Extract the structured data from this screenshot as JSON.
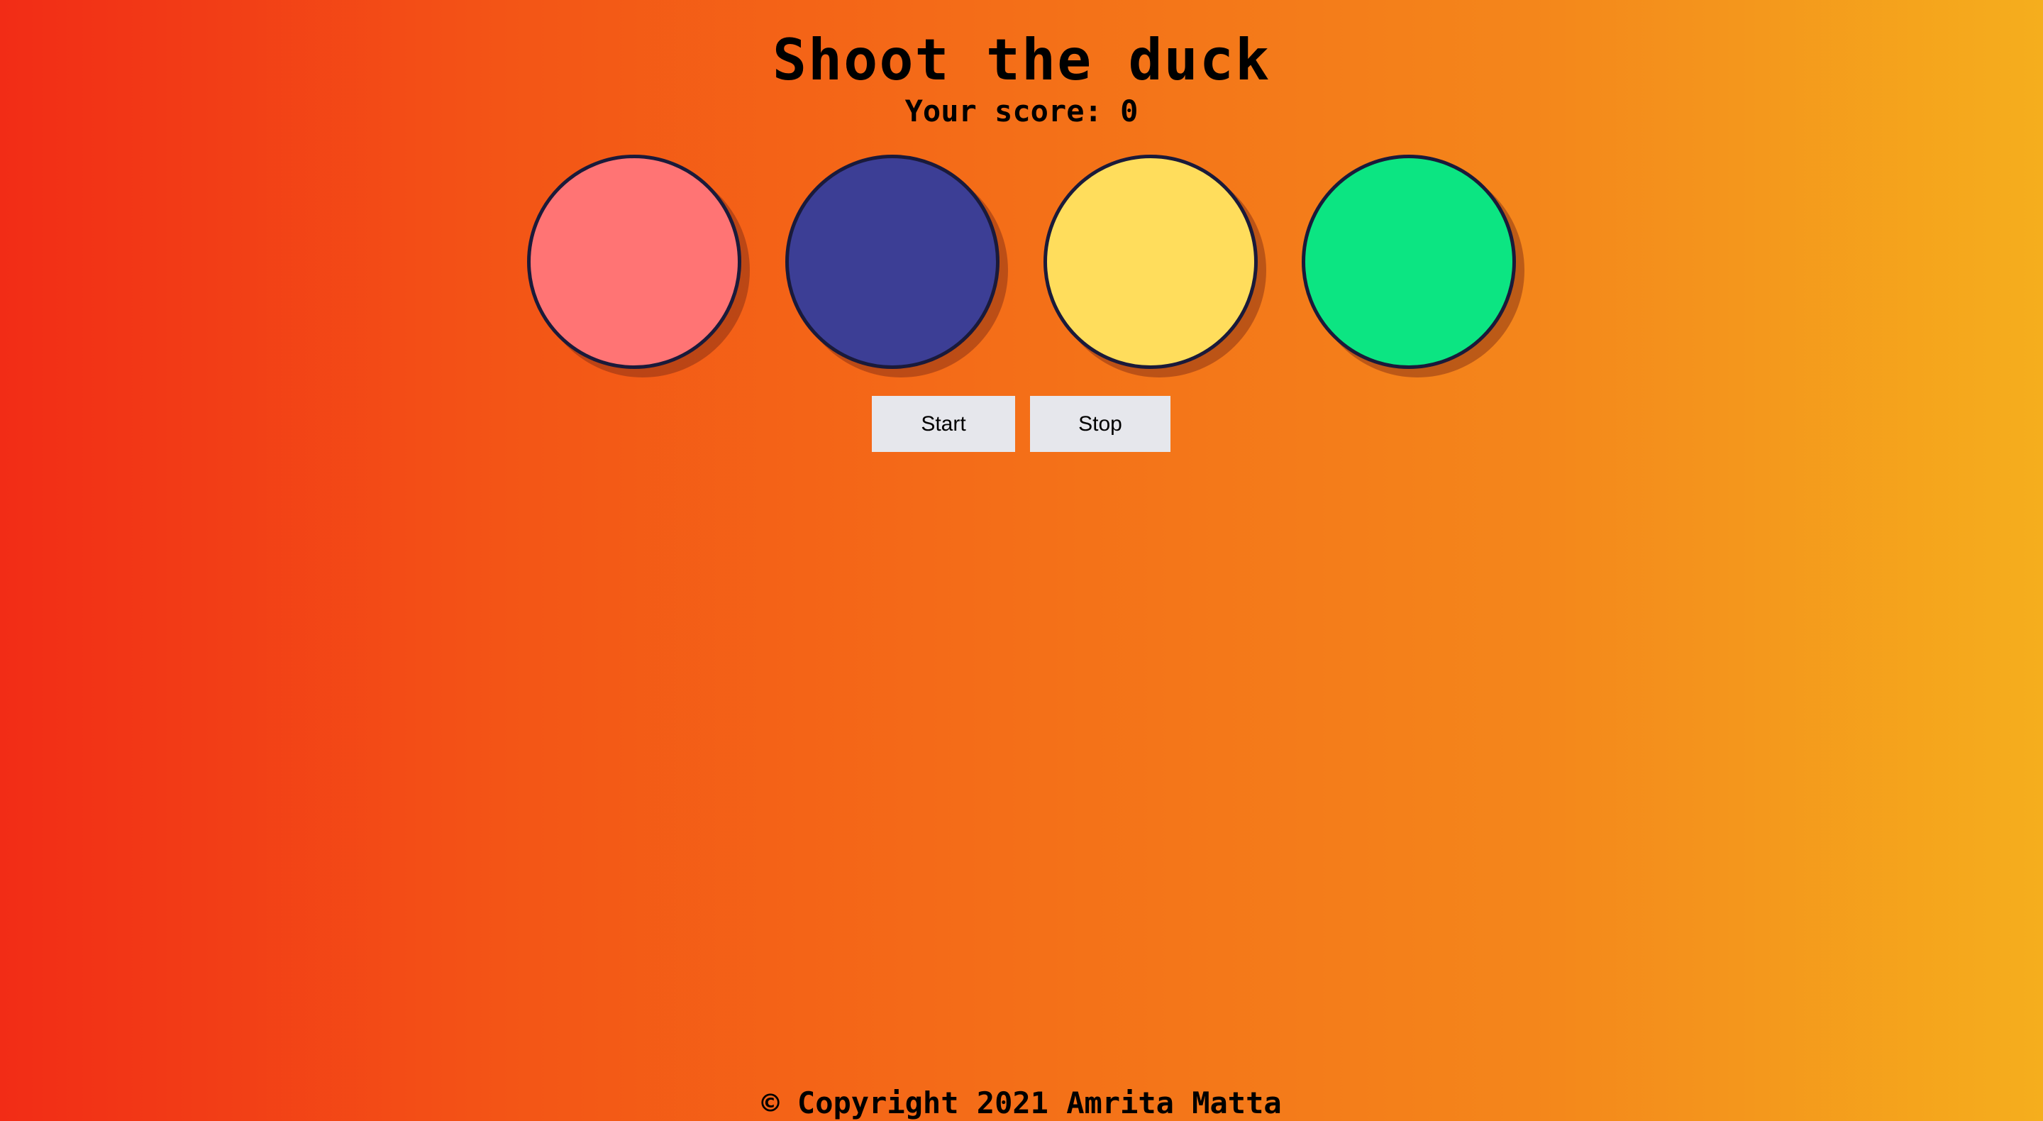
{
  "header": {
    "title": "Shoot the duck",
    "score_label": "Your score:",
    "score_value": "0"
  },
  "targets": [
    {
      "color": "#ff7474"
    },
    {
      "color": "#3c3e95"
    },
    {
      "color": "#ffdd5c"
    },
    {
      "color": "#0ce582"
    }
  ],
  "controls": {
    "start_label": "Start",
    "stop_label": "Stop"
  },
  "footer": {
    "copyright": "© Copyright 2021 Amrita Matta"
  }
}
